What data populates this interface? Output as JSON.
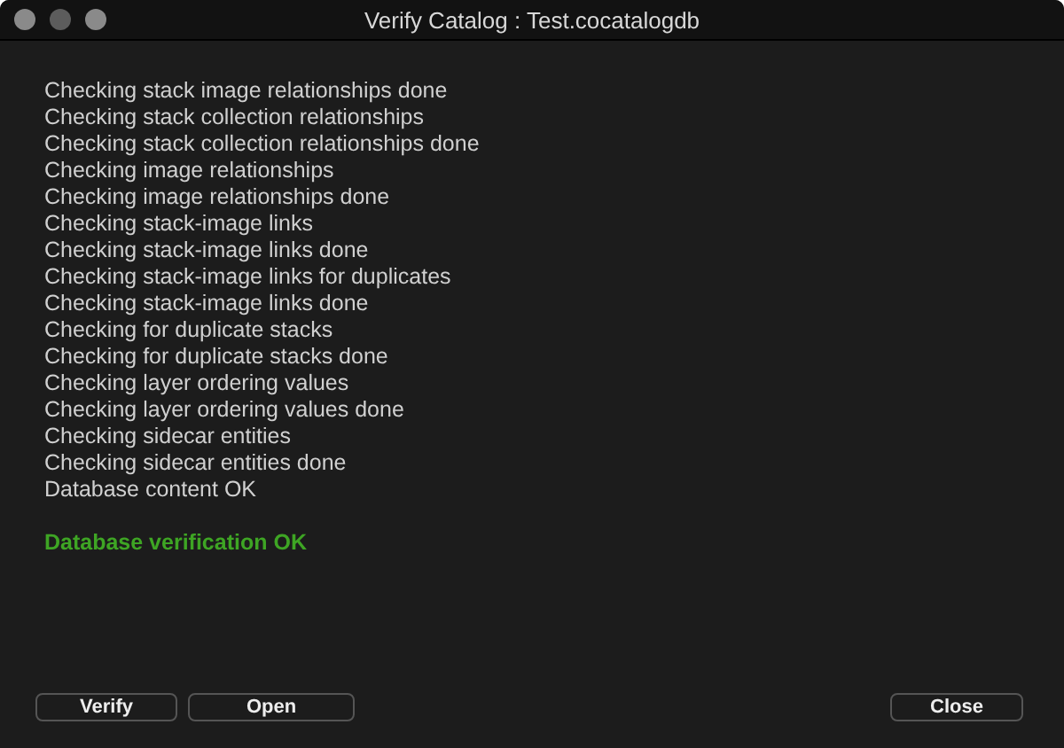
{
  "window": {
    "title": "Verify Catalog : Test.cocatalogdb"
  },
  "log_lines": [
    "Checking stack image relationships done",
    "Checking stack collection relationships",
    "Checking stack collection relationships done",
    "Checking image relationships",
    "Checking image relationships done",
    "Checking stack-image links",
    "Checking stack-image links done",
    "Checking stack-image links for duplicates",
    "Checking stack-image links done",
    "Checking for duplicate stacks",
    "Checking for duplicate stacks done",
    "Checking layer ordering values",
    "Checking layer ordering values done",
    "Checking sidecar entities",
    "Checking sidecar entities done",
    "Database content OK"
  ],
  "result": "Database verification OK",
  "buttons_left": [
    "Verify",
    "Open"
  ],
  "buttons_right": [
    "Close"
  ]
}
